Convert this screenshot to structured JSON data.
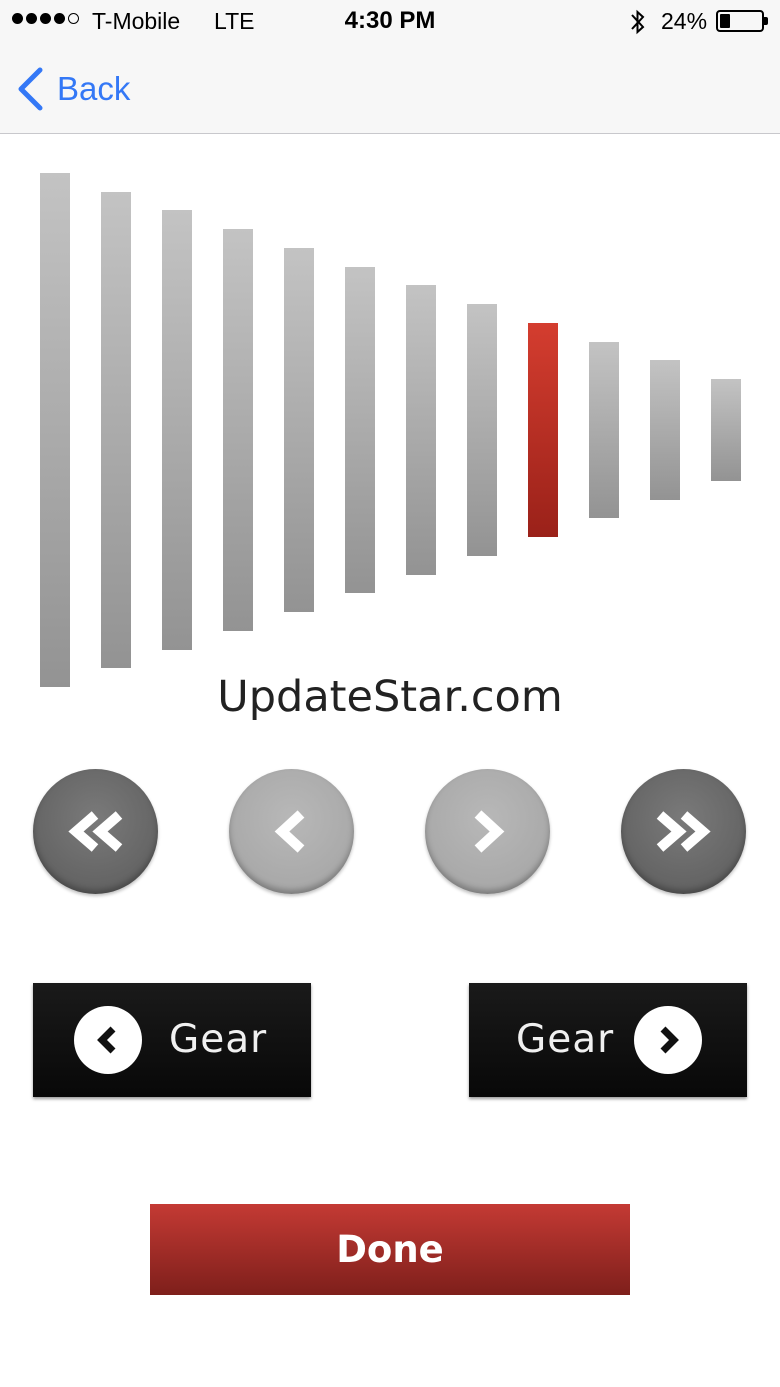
{
  "status_bar": {
    "signal_dots_filled": 4,
    "signal_dots_total": 5,
    "carrier": "T-Mobile",
    "network": "LTE",
    "time": "4:30 PM",
    "bluetooth_icon": "bluetooth-icon",
    "battery_percent": "24%",
    "battery_level": 0.24
  },
  "nav": {
    "back_label": "Back",
    "back_icon": "chevron-left-icon"
  },
  "gear_bars": {
    "count": 12,
    "selected_index": 8,
    "colors": {
      "inactive": "#b0b0b0",
      "active": "#c0352a"
    }
  },
  "watermark": "UpdateStar.com",
  "controls": {
    "first_icon": "double-chevron-left-icon",
    "prev_icon": "chevron-left-icon",
    "next_icon": "chevron-right-icon",
    "last_icon": "double-chevron-right-icon"
  },
  "gear_down": {
    "label": "Gear",
    "icon": "chevron-left-circle-icon"
  },
  "gear_up": {
    "label": "Gear",
    "icon": "chevron-right-circle-icon"
  },
  "done": {
    "label": "Done",
    "color": "#b0302a"
  },
  "colors": {
    "accent": "#3478f6"
  }
}
